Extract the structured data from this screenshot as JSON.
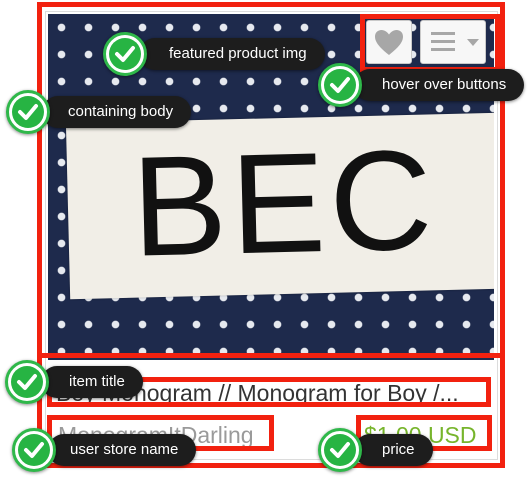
{
  "product": {
    "monogram_text": "BEC",
    "title": "Boy Monogram // Monogram for Boy /...",
    "store_name": "MonogramItDarling",
    "price": "$1.00 USD"
  },
  "colors": {
    "highlight": "#f2210f",
    "callout_check": "#27b443",
    "callout_pill": "#1d1d1d",
    "price": "#77b52c",
    "image_background": "#1e2a4c"
  },
  "icons": {
    "favorite": "heart-icon",
    "menu": "list-menu-icon",
    "menu_dropdown": "caret-down-icon",
    "callout": "checkmark-icon"
  },
  "callouts": {
    "featured_product_img": "featured product img",
    "hover_over_buttons": "hover over buttons",
    "containing_body": "containing body",
    "item_title": "item title",
    "user_store_name": "user store name",
    "price": "price"
  }
}
